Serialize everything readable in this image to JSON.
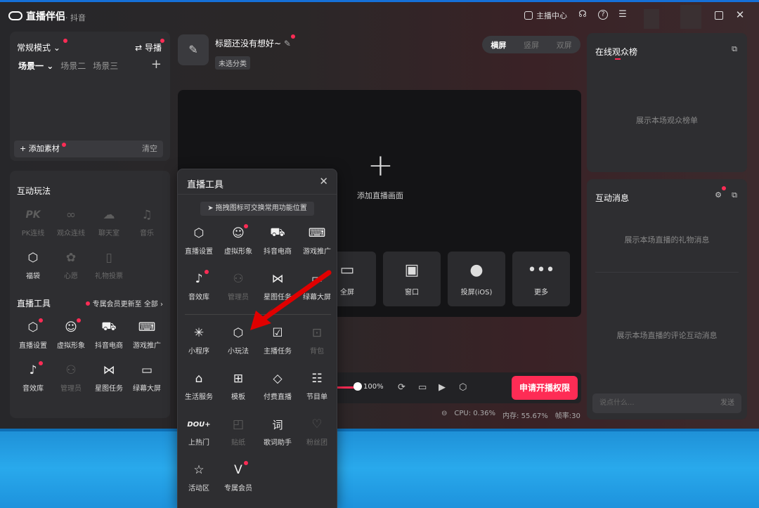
{
  "app": {
    "name": "直播伴侣",
    "sub": "· 抖音"
  },
  "titlebar": {
    "host_center": "主播中心"
  },
  "scene_panel": {
    "mode": "常规模式",
    "guide": "导播",
    "scenes": [
      "场景一",
      "场景二",
      "场景三"
    ],
    "add_material": "添加素材",
    "clear": "清空"
  },
  "interactive": {
    "title": "互动玩法",
    "items": [
      "PK连线",
      "观众连线",
      "聊天室",
      "音乐",
      "福袋",
      "心愿",
      "礼物投票"
    ]
  },
  "live_tools": {
    "title": "直播工具",
    "member_hint": "专属会员更新至",
    "all": "全部 ›",
    "items": [
      "直播设置",
      "虚拟形象",
      "抖音电商",
      "游戏推广",
      "音效库",
      "管理员",
      "星图任务",
      "绿幕大屏"
    ]
  },
  "header": {
    "title": "标题还没有想好~",
    "category": "未选分类"
  },
  "orientation": {
    "options": [
      "横屏",
      "竖屏",
      "双屏"
    ],
    "selected": "横屏"
  },
  "stage": {
    "add": "添加直播画面",
    "sources": [
      "全屏",
      "窗口",
      "投屏(iOS)",
      "更多"
    ]
  },
  "controls": {
    "volume": "100%",
    "apply": "申请开播权限"
  },
  "status": {
    "cpu": "CPU: 0.36%",
    "mem": "内存: 55.67%",
    "fps": "帧率:30"
  },
  "rank_panel": {
    "title": "在线观众榜",
    "placeholder": "展示本场观众榜单"
  },
  "msg_panel": {
    "title": "互动消息",
    "gift_placeholder": "展示本场直播的礼物消息",
    "comment_placeholder": "展示本场直播的评论互动消息",
    "chat_placeholder": "说点什么...",
    "send": "发送"
  },
  "popup": {
    "title": "直播工具",
    "hint": "拖拽图标可交换常用功能位置",
    "top_items": [
      "直播设置",
      "虚拟形象",
      "抖音电商",
      "游戏推广",
      "音效库",
      "管理员",
      "星图任务",
      "绿幕大屏"
    ],
    "more_items": [
      "小程序",
      "小玩法",
      "主播任务",
      "背包",
      "生活服务",
      "模板",
      "付费直播",
      "节目单",
      "上热门",
      "贴纸",
      "歌词助手",
      "粉丝团",
      "活动区",
      "专属会员"
    ],
    "dou_logo": "DOU+"
  },
  "colors": {
    "accent": "#fe2c55",
    "panel": "#2e2e31"
  }
}
